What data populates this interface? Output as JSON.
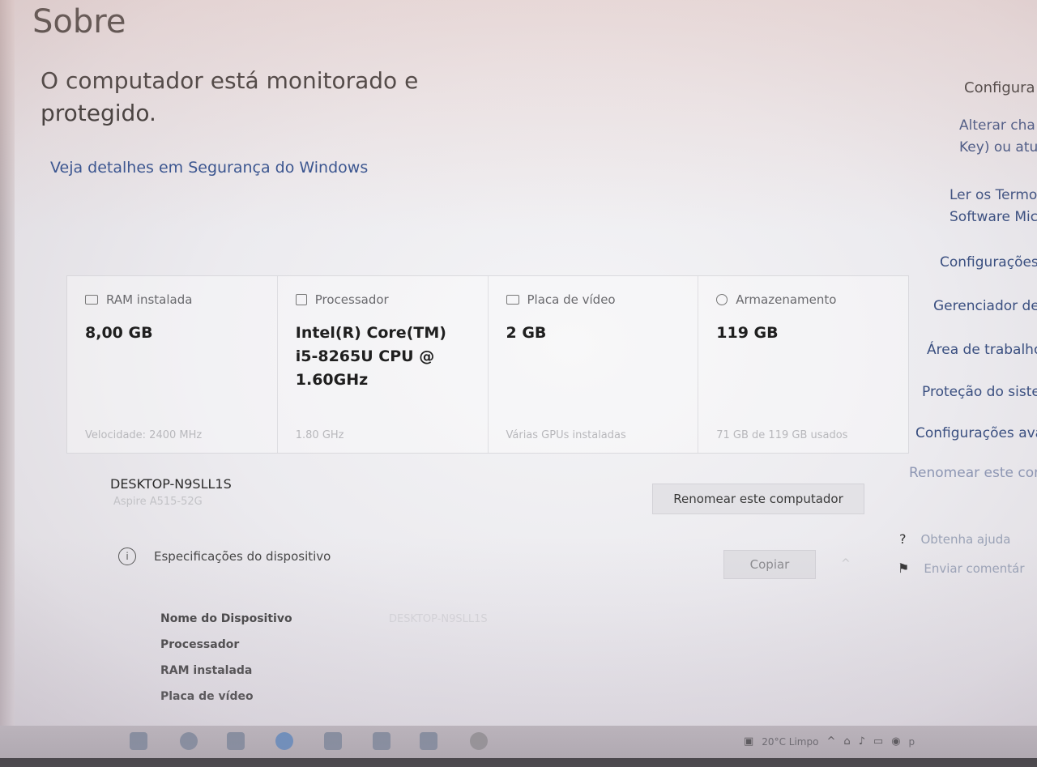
{
  "page": {
    "title": "Sobre",
    "protection_status": "O computador está monitorado e protegido.",
    "security_link": "Veja detalhes em Segurança do Windows"
  },
  "specs_cards": [
    {
      "icon": "ram-icon",
      "label": "RAM instalada",
      "value": "8,00 GB",
      "sub": "Velocidade: 2400 MHz"
    },
    {
      "icon": "processor-icon",
      "label": "Processador",
      "value": "Intel(R) Core(TM) i5-8265U CPU @ 1.60GHz",
      "sub": "1.80 GHz"
    },
    {
      "icon": "gpu-icon",
      "label": "Placa de vídeo",
      "value": "2 GB",
      "sub": "Várias GPUs instaladas"
    },
    {
      "icon": "storage-icon",
      "label": "Armazenamento",
      "value": "119 GB",
      "sub": "71 GB de 119 GB usados"
    }
  ],
  "device": {
    "name": "DESKTOP-N9SLL1S",
    "model": "Aspire A515-52G",
    "rename_button": "Renomear este computador"
  },
  "device_specs": {
    "header": "Especificações do dispositivo",
    "copy_button": "Copiar",
    "rows": [
      {
        "label": "Nome do Dispositivo",
        "value": "DESKTOP-N9SLL1S"
      },
      {
        "label": "Processador",
        "value": ""
      },
      {
        "label": "RAM instalada",
        "value": ""
      },
      {
        "label": "Placa de vídeo",
        "value": ""
      }
    ]
  },
  "side_rail": {
    "heading": "Configura",
    "change_key_1": "Alterar cha",
    "change_key_2": "Key) ou atu",
    "terms_1": "Ler os Termo",
    "terms_2": "Software Mic",
    "links": [
      "Configurações",
      "Gerenciador de",
      "Área de trabalho",
      "Proteção do siste",
      "Configurações ava",
      "Renomear este com"
    ],
    "help": "Obtenha ajuda",
    "feedback": "Enviar comentár"
  },
  "taskbar": {
    "tray_text": "20°C  Limpo",
    "tray_extra": "p"
  },
  "colors": {
    "link": "#2a4b8c",
    "button_bg": "#e3e2e6",
    "text": "#2b2b2b"
  }
}
